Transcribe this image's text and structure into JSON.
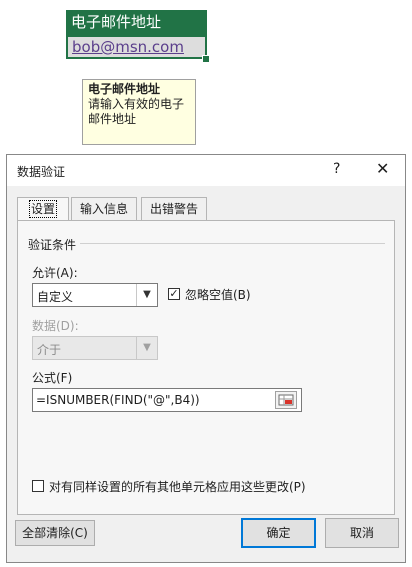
{
  "sheet": {
    "header_cell": "电子邮件地址",
    "value_cell": "bob@msn.com"
  },
  "tooltip": {
    "title": "电子邮件地址",
    "message_line1": "请输入有效的电子",
    "message_line2": "邮件地址"
  },
  "dialog": {
    "title": "数据验证",
    "help": "?",
    "close": "✕",
    "tabs": [
      {
        "label": "设置"
      },
      {
        "label": "输入信息"
      },
      {
        "label": "出错警告"
      }
    ],
    "section_title": "验证条件",
    "allow_label": "允许(A):",
    "allow_value": "自定义",
    "ignore_blank_label": "忽略空值(B)",
    "ignore_blank_checked": "✓",
    "data_label": "数据(D):",
    "data_value": "介于",
    "formula_label": "公式(F)",
    "formula_value": "=ISNUMBER(FIND(\"@\",B4))",
    "apply_all_label": "对有同样设置的所有其他单元格应用这些更改(P)",
    "clear_all": "全部清除(C)",
    "ok": "确定",
    "cancel": "取消"
  }
}
